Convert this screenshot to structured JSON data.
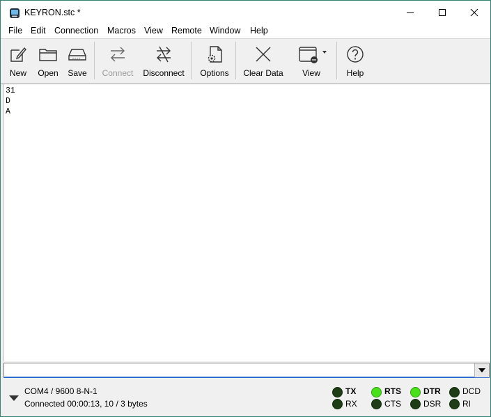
{
  "window": {
    "title": "KEYRON.stc *"
  },
  "menu": [
    "File",
    "Edit",
    "Connection",
    "Macros",
    "View",
    "Remote",
    "Window",
    "Help"
  ],
  "toolbar": {
    "new": "New",
    "open": "Open",
    "save": "Save",
    "connect": "Connect",
    "disconnect": "Disconnect",
    "options": "Options",
    "clear": "Clear Data",
    "view": "View",
    "help": "Help"
  },
  "terminal": {
    "lines": [
      "31",
      "D",
      "A"
    ]
  },
  "input": {
    "value": ""
  },
  "status": {
    "port": "COM4 / 9600 8-N-1",
    "connection": "Connected 00:00:13, 10 / 3 bytes",
    "signals": [
      {
        "name": "TX",
        "on": false
      },
      {
        "name": "RX",
        "on": false
      },
      {
        "name": "RTS",
        "on": true
      },
      {
        "name": "CTS",
        "on": false
      },
      {
        "name": "DTR",
        "on": true
      },
      {
        "name": "DSR",
        "on": false
      },
      {
        "name": "DCD",
        "on": false
      },
      {
        "name": "RI",
        "on": false
      }
    ]
  },
  "colors": {
    "led_on": "#49e01b",
    "led_off": "#1f3d17",
    "focus": "#2b6fd0"
  }
}
